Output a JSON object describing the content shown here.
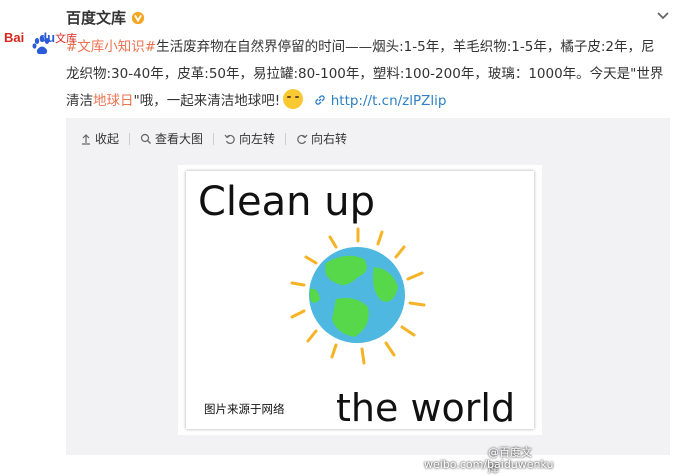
{
  "account": {
    "name": "百度文库",
    "logo_text_main": "Bai",
    "logo_text_du": "du",
    "logo_text_wk": "文库",
    "verified": true
  },
  "post": {
    "hashtag": "#文库小知识#",
    "text_line1": "生活废弃物在自然界停留的时间——烟头:1-5年，羊毛织物:1-5年，橘子皮:2年，尼龙织物:30-40年，皮革:50年，易拉罐:80-100年，塑料:100-200年，玻璃：1000年。今天是\"世界清洁",
    "highlight": "地球日",
    "text_tail": "\"哦，一起来清洁地球吧!",
    "short_link": "http://t.cn/zlPZlip"
  },
  "toolbar": {
    "collapse": "收起",
    "view_large": "查看大图",
    "rotate_left": "向左转",
    "rotate_right": "向右转"
  },
  "image": {
    "headline_top": "Clean up",
    "headline_bottom": "the world",
    "caption": "图片来源于网络",
    "watermark_handle": "@百度文库",
    "watermark_url": "weibo.com/baiduwenku"
  },
  "colors": {
    "link": "#eb7350",
    "url": "#2d80c5",
    "panel_bg": "#f2f2f5",
    "verified_badge": "#f5a623"
  }
}
